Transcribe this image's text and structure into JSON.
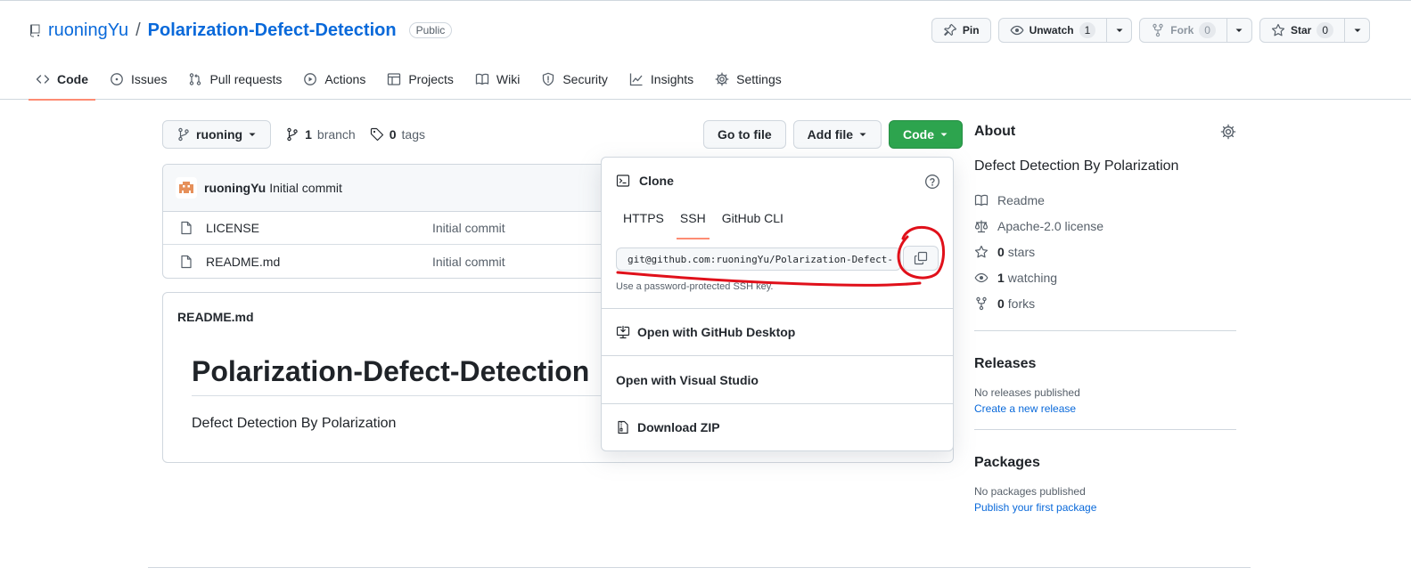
{
  "repo": {
    "owner": "ruoningYu",
    "separator": "/",
    "name": "Polarization-Defect-Detection",
    "visibility": "Public"
  },
  "header_actions": {
    "pin": "Pin",
    "unwatch": "Unwatch",
    "unwatch_count": "1",
    "fork": "Fork",
    "fork_count": "0",
    "star": "Star",
    "star_count": "0"
  },
  "tabs": [
    {
      "label": "Code",
      "icon": "code-icon",
      "active": true
    },
    {
      "label": "Issues",
      "icon": "issue-icon"
    },
    {
      "label": "Pull requests",
      "icon": "pull-request-icon"
    },
    {
      "label": "Actions",
      "icon": "play-icon"
    },
    {
      "label": "Projects",
      "icon": "table-icon"
    },
    {
      "label": "Wiki",
      "icon": "book-icon"
    },
    {
      "label": "Security",
      "icon": "shield-icon"
    },
    {
      "label": "Insights",
      "icon": "graph-icon"
    },
    {
      "label": "Settings",
      "icon": "gear-icon"
    }
  ],
  "toolbar": {
    "branch": "ruoning",
    "branch_count": "1",
    "branch_label": "branch",
    "tag_count": "0",
    "tag_label": "tags",
    "go_to_file": "Go to file",
    "add_file": "Add file",
    "code": "Code"
  },
  "commit": {
    "user": "ruoningYu",
    "message": "Initial commit"
  },
  "files": [
    {
      "name": "LICENSE",
      "message": "Initial commit"
    },
    {
      "name": "README.md",
      "message": "Initial commit"
    }
  ],
  "readme": {
    "filename": "README.md",
    "heading": "Polarization-Defect-Detection",
    "body": "Defect Detection By Polarization"
  },
  "clone": {
    "title": "Clone",
    "tabs": [
      "HTTPS",
      "SSH",
      "GitHub CLI"
    ],
    "active_tab": "SSH",
    "url": "git@github.com:ruoningYu/Polarization-Defect-",
    "hint": "Use a password-protected SSH key.",
    "open_desktop": "Open with GitHub Desktop",
    "open_vs": "Open with Visual Studio",
    "download_zip": "Download ZIP"
  },
  "about": {
    "title": "About",
    "description": "Defect Detection By Polarization",
    "readme": "Readme",
    "license": "Apache-2.0 license",
    "stars_count": "0",
    "stars_label": "stars",
    "watching_count": "1",
    "watching_label": "watching",
    "forks_count": "0",
    "forks_label": "forks"
  },
  "releases": {
    "title": "Releases",
    "empty": "No releases published",
    "link": "Create a new release"
  },
  "packages": {
    "title": "Packages",
    "empty": "No packages published",
    "link": "Publish your first package"
  },
  "colors": {
    "link": "#0969da",
    "primary_green": "#2da44e",
    "tab_underline": "#fd8c73",
    "annotation_red": "#e0101a"
  }
}
